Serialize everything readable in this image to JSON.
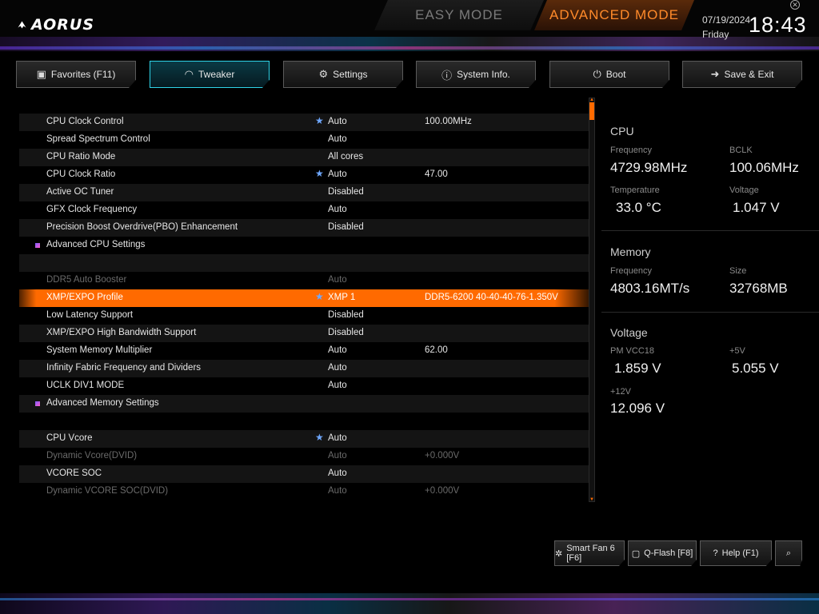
{
  "header": {
    "logo_text": "AORUS",
    "easy_mode": "EASY MODE",
    "advanced_mode": "ADVANCED MODE",
    "date": "07/19/2024",
    "day": "Friday",
    "time": "18:43"
  },
  "tabs": [
    {
      "label": "Favorites (F11)",
      "icon": "favorites-icon"
    },
    {
      "label": "Tweaker",
      "icon": "speedometer-icon",
      "active": true
    },
    {
      "label": "Settings",
      "icon": "gear-icon"
    },
    {
      "label": "System Info.",
      "icon": "info-icon"
    },
    {
      "label": "Boot",
      "icon": "power-icon"
    },
    {
      "label": "Save & Exit",
      "icon": "exit-icon"
    }
  ],
  "settings": [
    {
      "label": "",
      "value": "",
      "extra": ""
    },
    {
      "label": "CPU Clock Control",
      "value": "Auto",
      "extra": "100.00MHz",
      "star": true
    },
    {
      "label": "Spread Spectrum Control",
      "value": "Auto",
      "extra": ""
    },
    {
      "label": "CPU Ratio Mode",
      "value": "All cores",
      "extra": ""
    },
    {
      "label": "CPU Clock Ratio",
      "value": "Auto",
      "extra": "47.00",
      "star": true
    },
    {
      "label": "Active OC Tuner",
      "value": "Disabled",
      "extra": ""
    },
    {
      "label": "GFX Clock Frequency",
      "value": "Auto",
      "extra": ""
    },
    {
      "label": "Precision Boost Overdrive(PBO) Enhancement",
      "value": "Disabled",
      "extra": ""
    },
    {
      "label": "Advanced CPU Settings",
      "value": "",
      "extra": "",
      "submenu": true
    },
    {
      "label": "",
      "value": "",
      "extra": ""
    },
    {
      "label": "DDR5 Auto Booster",
      "value": "Auto",
      "extra": "",
      "disabled": true
    },
    {
      "label": "XMP/EXPO Profile",
      "value": "XMP 1",
      "extra": "DDR5-6200 40-40-40-76-1.350V",
      "star": true,
      "selected": true
    },
    {
      "label": "Low Latency Support",
      "value": "Disabled",
      "extra": ""
    },
    {
      "label": "XMP/EXPO High Bandwidth Support",
      "value": "Disabled",
      "extra": ""
    },
    {
      "label": "System Memory Multiplier",
      "value": "Auto",
      "extra": "62.00"
    },
    {
      "label": "Infinity Fabric Frequency and Dividers",
      "value": "Auto",
      "extra": ""
    },
    {
      "label": "UCLK DIV1 MODE",
      "value": "Auto",
      "extra": ""
    },
    {
      "label": "Advanced Memory Settings",
      "value": "",
      "extra": "",
      "submenu": true
    },
    {
      "label": "",
      "value": "",
      "extra": ""
    },
    {
      "label": "CPU Vcore",
      "value": "Auto",
      "extra": "",
      "star": true
    },
    {
      "label": "Dynamic Vcore(DVID)",
      "value": "Auto",
      "extra": "+0.000V",
      "disabled": true
    },
    {
      "label": "VCORE SOC",
      "value": "Auto",
      "extra": ""
    },
    {
      "label": "Dynamic VCORE SOC(DVID)",
      "value": "Auto",
      "extra": "+0.000V",
      "disabled": true
    }
  ],
  "panel": {
    "cpu": {
      "title": "CPU",
      "frequency_label": "Frequency",
      "frequency": "4729.98MHz",
      "bclk_label": "BCLK",
      "bclk": "100.06MHz",
      "temperature_label": "Temperature",
      "temperature": "33.0 °C",
      "voltage_label": "Voltage",
      "voltage": "1.047 V"
    },
    "memory": {
      "title": "Memory",
      "frequency_label": "Frequency",
      "frequency": "4803.16MT/s",
      "size_label": "Size",
      "size": "32768MB"
    },
    "voltage": {
      "title": "Voltage",
      "pm_vcc18_label": "PM VCC18",
      "pm_vcc18": "1.859 V",
      "p5v_label": "+5V",
      "p5v": "5.055 V",
      "p12v_label": "+12V",
      "p12v": "12.096 V"
    }
  },
  "bottom": {
    "smart_fan": "Smart Fan 6 [F6]",
    "qflash": "Q-Flash [F8]",
    "help": "Help (F1)"
  },
  "colors": {
    "accent": "#ff6a00",
    "active_tab": "#2fd3e8"
  }
}
